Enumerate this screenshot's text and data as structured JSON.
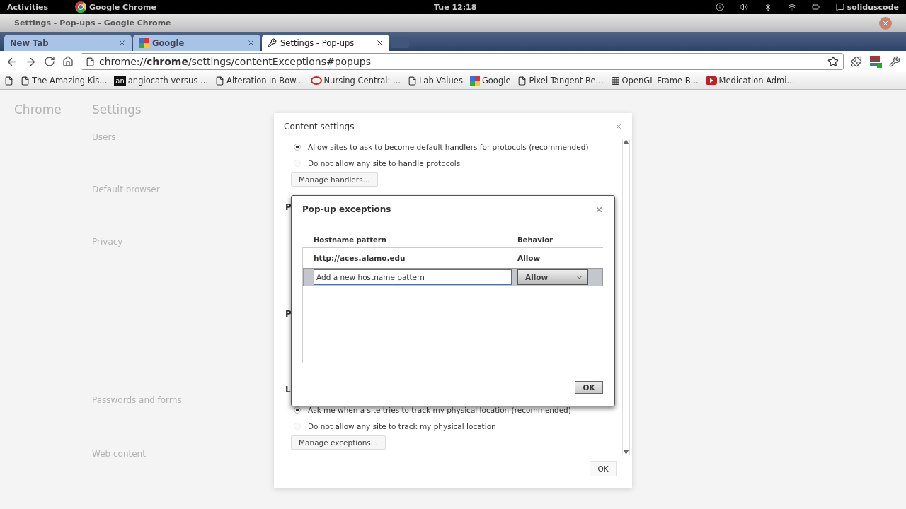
{
  "top_bar": {
    "activities": "Activities",
    "app_name": "Google Chrome",
    "clock": "Tue 12:18",
    "user": "soliduscode"
  },
  "window": {
    "title": "Settings - Pop-ups - Google Chrome"
  },
  "tabs": [
    {
      "label": "New Tab",
      "selected": false,
      "kind": "blank"
    },
    {
      "label": "Google",
      "selected": false,
      "kind": "google"
    },
    {
      "label": "Settings - Pop-ups",
      "selected": true,
      "kind": "wrench"
    }
  ],
  "address_bar": {
    "url": "chrome://**chrome**/settings/contentExceptions#popups"
  },
  "bookmarks": [
    {
      "label": "The Amazing Kis...",
      "kind": "page"
    },
    {
      "label": "angiocath versus ...",
      "kind": "an",
      "badge": "an"
    },
    {
      "label": "Alteration in Bow...",
      "kind": "page"
    },
    {
      "label": "Nursing Central: ...",
      "kind": "ring"
    },
    {
      "label": "Lab Values",
      "kind": "page"
    },
    {
      "label": "Google",
      "kind": "google"
    },
    {
      "label": "Pixel Tangent Re...",
      "kind": "page"
    },
    {
      "label": "OpenGL Frame B...",
      "kind": "grid"
    },
    {
      "label": "Medication Admi...",
      "kind": "video"
    }
  ],
  "settings_page": {
    "nav_title": "Chrome",
    "title": "Settings",
    "sections": [
      "Users",
      "Default browser",
      "Privacy",
      "Passwords and forms",
      "Web content"
    ]
  },
  "content_settings": {
    "title": "Content settings",
    "top_options": [
      {
        "label": "Allow sites to ask to become default handlers for protocols (recommended)",
        "selected": true
      },
      {
        "label": "Do not allow any site to handle protocols",
        "selected": false
      }
    ],
    "top_button": "Manage handlers...",
    "hidden_headings": [
      "P",
      "P",
      "L"
    ],
    "bottom_options": [
      {
        "label": "Ask me when a site tries to track my physical location (recommended)",
        "selected": true
      },
      {
        "label": "Do not allow any site to track my physical location",
        "selected": false
      }
    ],
    "bottom_button": "Manage exceptions...",
    "ok": "OK"
  },
  "popup_exceptions": {
    "title": "Pop-up exceptions",
    "columns": [
      "Hostname pattern",
      "Behavior"
    ],
    "rows": [
      {
        "pattern": "http://aces.alamo.edu",
        "behavior": "Allow",
        "selected": false
      }
    ],
    "new_row": {
      "placeholder": "Add a new hostname pattern",
      "behavior": "Allow",
      "selected": true
    },
    "ok": "OK"
  }
}
